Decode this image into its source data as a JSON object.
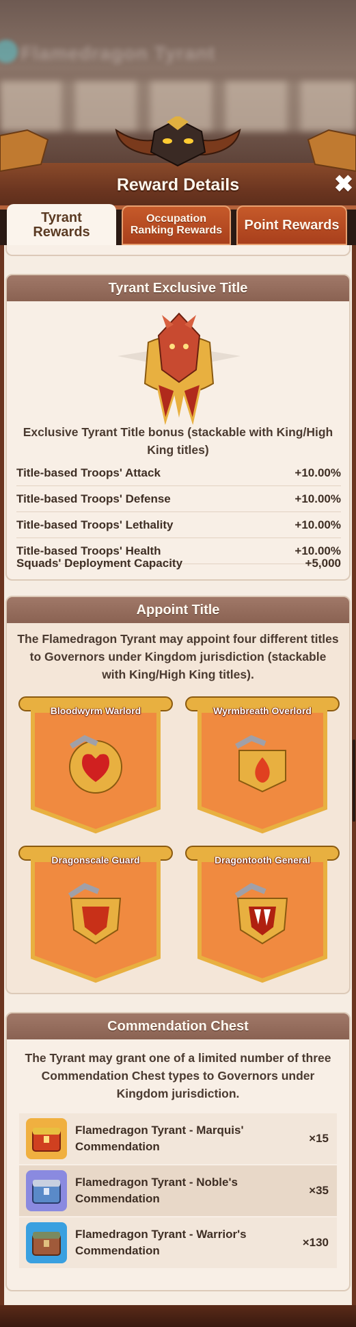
{
  "background": {
    "blurred_title": "Flamedragon Tyrant"
  },
  "header": {
    "title": "Reward Details",
    "close_label": "✖"
  },
  "tabs": [
    {
      "label": "Tyrant Rewards",
      "active": true
    },
    {
      "label": "Occupation Ranking Rewards",
      "active": false
    },
    {
      "label": "Point Rewards",
      "active": false
    }
  ],
  "exclusive_title": {
    "heading": "Tyrant Exclusive Title",
    "description": "Exclusive Tyrant Title bonus (stackable with King/High King titles)",
    "stats": [
      {
        "label": "Title-based Troops' Attack",
        "value": "+10.00%"
      },
      {
        "label": "Title-based Troops' Defense",
        "value": "+10.00%"
      },
      {
        "label": "Title-based Troops' Lethality",
        "value": "+10.00%"
      },
      {
        "label": "Title-based Troops' Health",
        "value": "+10.00%"
      },
      {
        "label": "Squads' Deployment Capacity",
        "value": "+5,000"
      }
    ]
  },
  "appoint": {
    "heading": "Appoint Title",
    "description": "The Flamedragon Tyrant may appoint four different titles to Governors under Kingdom jurisdiction (stackable with King/High King titles).",
    "titles": [
      {
        "name": "Bloodwyrm Warlord",
        "icon": "heart-gem-icon"
      },
      {
        "name": "Wyrmbreath Overlord",
        "icon": "flame-gem-icon"
      },
      {
        "name": "Dragonscale Guard",
        "icon": "scale-shield-icon"
      },
      {
        "name": "Dragontooth General",
        "icon": "fang-shield-icon"
      }
    ]
  },
  "chest": {
    "heading": "Commendation Chest",
    "description": "The Tyrant may grant one of a limited number of three Commendation Chest types to Governors under Kingdom jurisdiction.",
    "items": [
      {
        "name": "Flamedragon Tyrant - Marquis' Commendation",
        "count": "×15",
        "color": "#f0a030"
      },
      {
        "name": "Flamedragon Tyrant - Noble's Commendation",
        "count": "×35",
        "color": "#8a8ae0"
      },
      {
        "name": "Flamedragon Tyrant - Warrior's Commendation",
        "count": "×130",
        "color": "#3aa0e0"
      }
    ]
  }
}
